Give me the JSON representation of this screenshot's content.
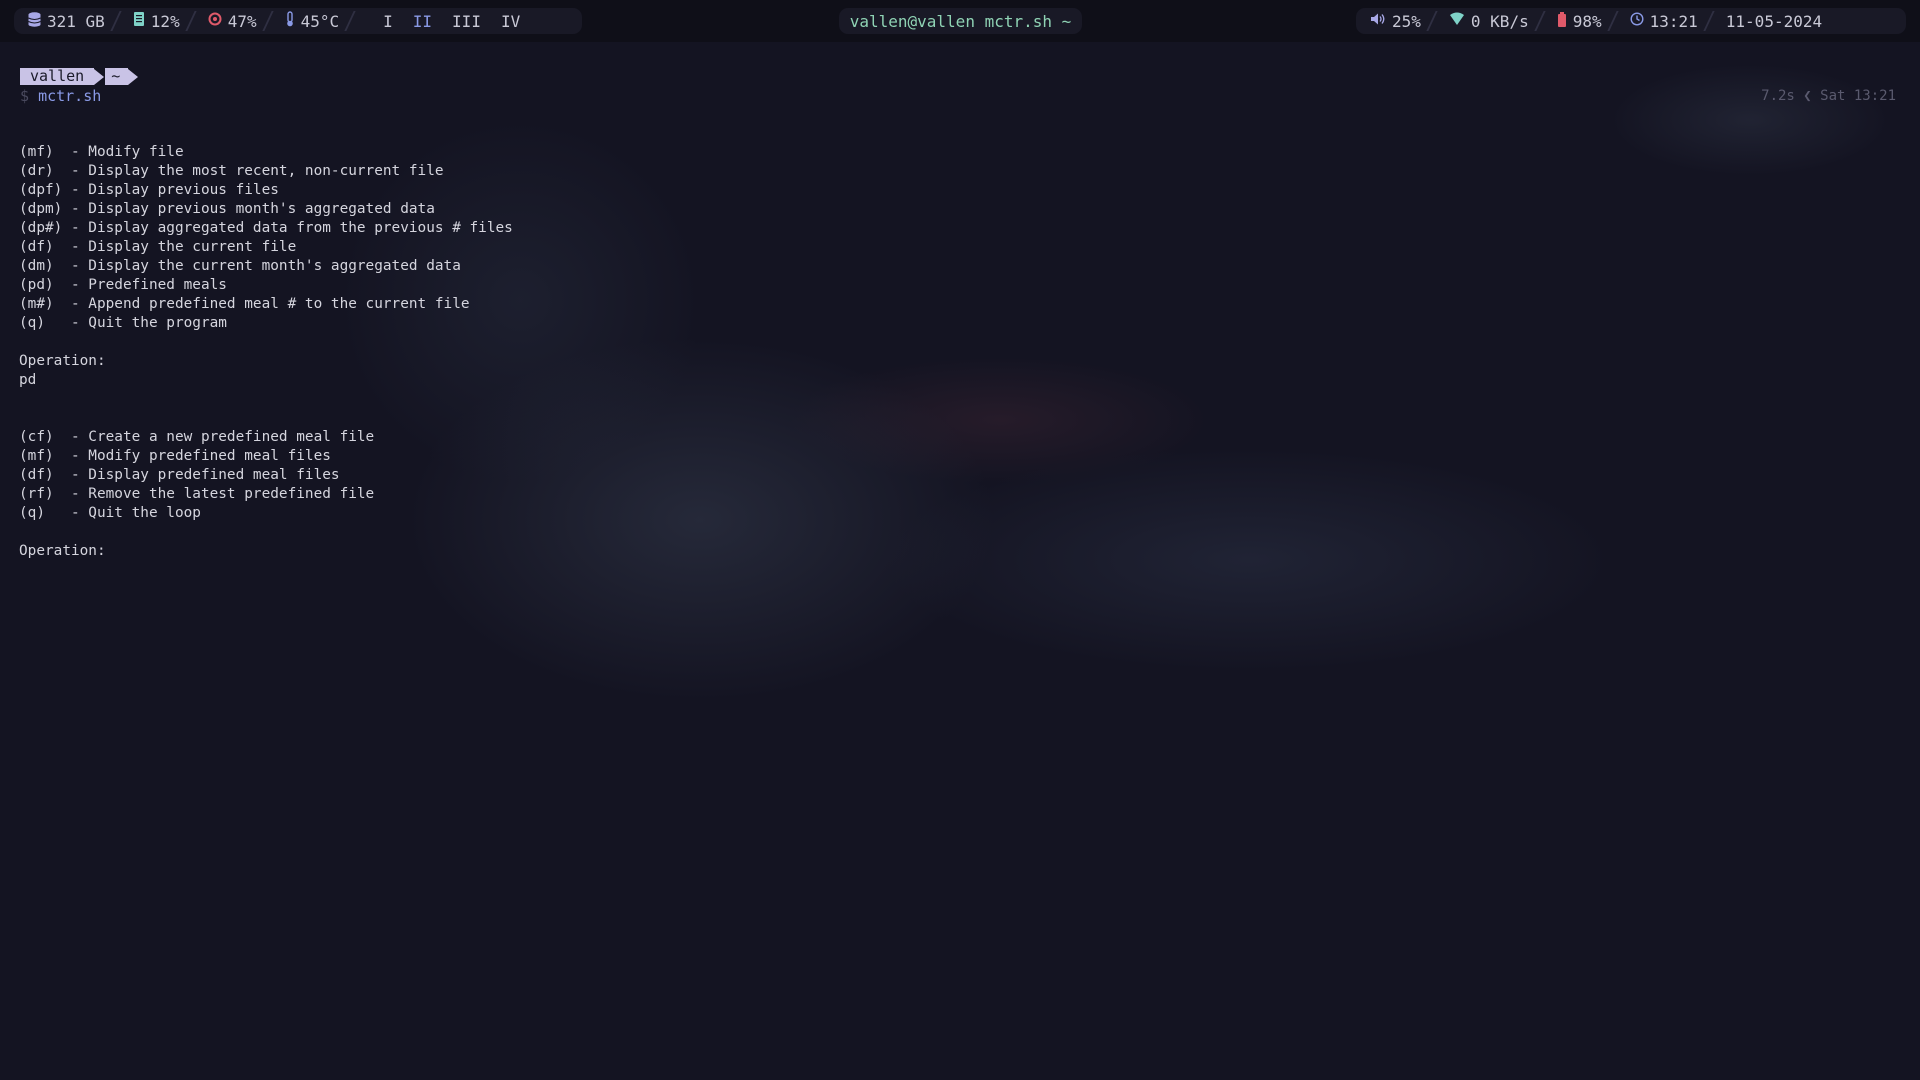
{
  "topbar": {
    "left": {
      "disk": "321 GB",
      "memory": "12%",
      "cpu": "47%",
      "temperature": "45°C",
      "workspaces": [
        "I",
        "II",
        "III",
        "IV"
      ],
      "active_workspace_index": 1
    },
    "center": {
      "window_title": "vallen@vallen mctr.sh ~"
    },
    "right": {
      "volume": "25%",
      "network": "0 KB/s",
      "battery": "98%",
      "time": "13:21",
      "date": "11-05-2024"
    },
    "icons": {
      "disk": "database-icon",
      "memory": "memory-icon",
      "cpu": "cpu-icon",
      "temperature": "thermometer-icon",
      "volume": "speaker-icon",
      "network": "wifi-icon",
      "battery": "battery-icon",
      "time": "clock-icon"
    },
    "colors": {
      "memory": "#7fd3c8",
      "cpu": "#e05a6a",
      "temperature": "#8a9ae6",
      "volume": "#a8a8e6",
      "network": "#7fd3c8",
      "battery": "#e05a6a",
      "time": "#8a9ae6",
      "title": "#8fd3b4"
    }
  },
  "terminal": {
    "prompt_user": "vallen",
    "prompt_dir": "~",
    "command_prefix": "$",
    "command": "mctr.sh",
    "right_prompt": "7.2s ❮ Sat 13:21",
    "output_lines": [
      "(mf)  - Modify file",
      "(dr)  - Display the most recent, non-current file",
      "(dpf) - Display previous files",
      "(dpm) - Display previous month's aggregated data",
      "(dp#) - Display aggregated data from the previous # files",
      "(df)  - Display the current file",
      "(dm)  - Display the current month's aggregated data",
      "(pd)  - Predefined meals",
      "(m#)  - Append predefined meal # to the current file",
      "(q)   - Quit the program",
      "",
      "Operation:",
      "pd",
      "",
      "",
      "(cf)  - Create a new predefined meal file",
      "(mf)  - Modify predefined meal files",
      "(df)  - Display predefined meal files",
      "(rf)  - Remove the latest predefined file",
      "(q)   - Quit the loop",
      "",
      "Operation:"
    ]
  }
}
